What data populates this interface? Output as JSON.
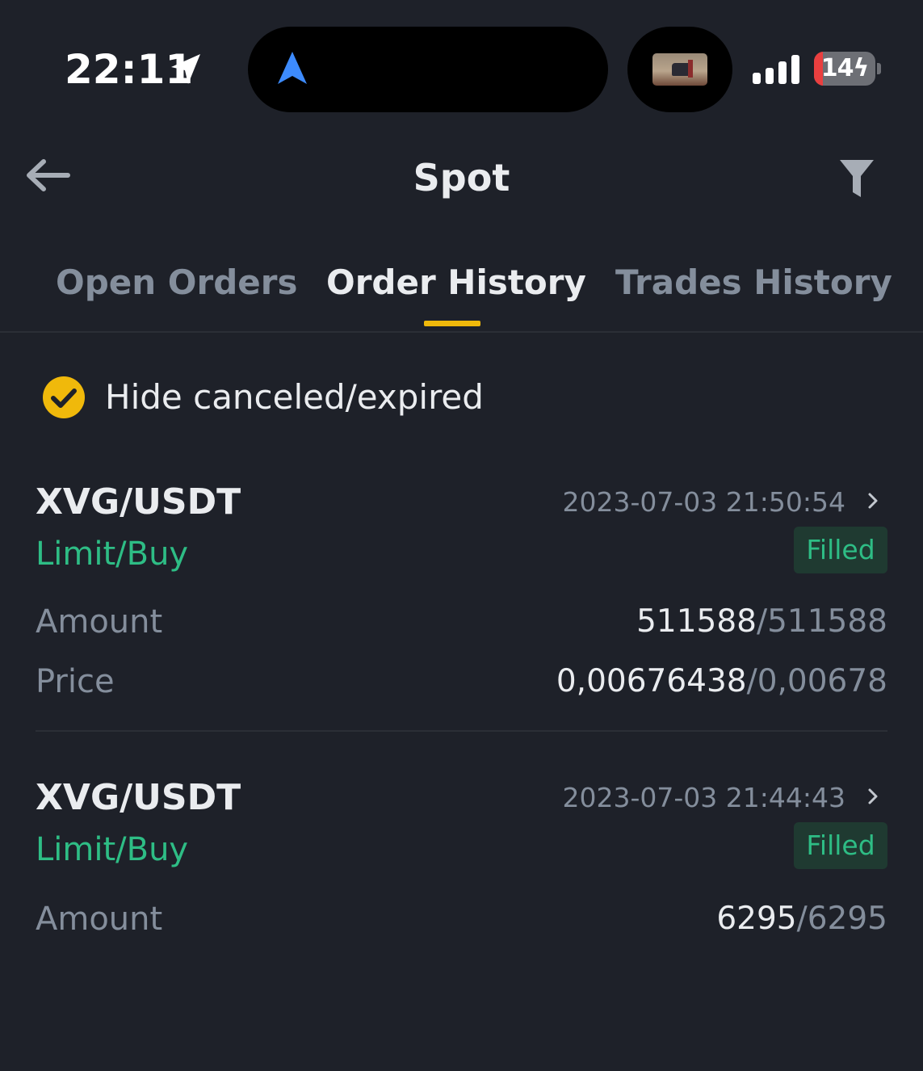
{
  "status_bar": {
    "time": "22:11",
    "battery": "14",
    "battery_level": 0.14,
    "icons": [
      "location-arrow-icon",
      "navigation-arrow-icon",
      "cellular-signal-icon",
      "battery-charging-icon"
    ]
  },
  "header": {
    "title": "Spot",
    "icons": [
      "back-arrow-icon",
      "filter-icon"
    ]
  },
  "tabs": [
    {
      "label": "Open Orders",
      "active": false
    },
    {
      "label": "Order History",
      "active": true
    },
    {
      "label": "Trades History",
      "active": false
    }
  ],
  "filter": {
    "hide_canceled_label": "Hide canceled/expired",
    "checked": true
  },
  "orders": [
    {
      "pair": "XVG/USDT",
      "timestamp": "2023-07-03 21:50:54",
      "side": "Limit/Buy",
      "status": "Filled",
      "amount_label": "Amount",
      "amount_filled": "511588",
      "amount_total": "511588",
      "price_label": "Price",
      "price_avg": "0,00676438",
      "price_limit": "0,00678"
    },
    {
      "pair": "XVG/USDT",
      "timestamp": "2023-07-03 21:44:43",
      "side": "Limit/Buy",
      "status": "Filled",
      "amount_label": "Amount",
      "amount_filled": "6295",
      "amount_total": "6295"
    }
  ],
  "colors": {
    "background": "#1e2129",
    "accent": "#f0b90b",
    "buy_green": "#2ebd85",
    "text_primary": "#eaecef",
    "text_secondary": "#848e9c"
  }
}
